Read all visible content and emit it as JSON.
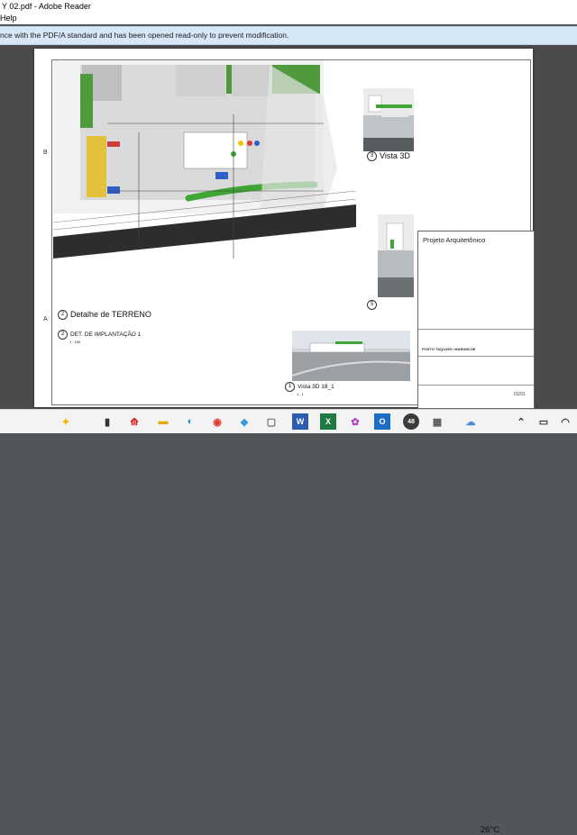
{
  "window": {
    "title": "Y 02.pdf - Adobe Reader"
  },
  "menu": {
    "help": "Help"
  },
  "notice": {
    "text": "nce with the PDF/A standard and has been opened read-only to prevent modification."
  },
  "drawing": {
    "row_label_b": "B",
    "row_label_a": "A",
    "detail_terreno": "Detalhe de TERRENO",
    "detail_terreno_num": "2",
    "det_implantacao": "DET. DE IMPLANTAÇÃO 1",
    "det_implantacao_num": "2",
    "det_implantacao_scale": "1 : 100",
    "vista3d_top": "Vista 3D",
    "vista3d_top_num": "3",
    "vista3d_mid_num": "5",
    "vista3d_bottom": "Vista 3D 18_1",
    "vista3d_bottom_num": "1",
    "vista3d_bottom_scale": "1 : 1"
  },
  "titleblock": {
    "title": "Projeto Arquitetônico",
    "project": "POSTO TAQUARI / MARUIM-SE",
    "sheet": "01/01"
  },
  "taskbar": {
    "temperature": "26°C",
    "badge": "48"
  },
  "colors": {
    "infobar": "#d6e7f7",
    "docbg": "#4b4b4b",
    "green": "#3fa535",
    "road": "#2d2d2d"
  }
}
